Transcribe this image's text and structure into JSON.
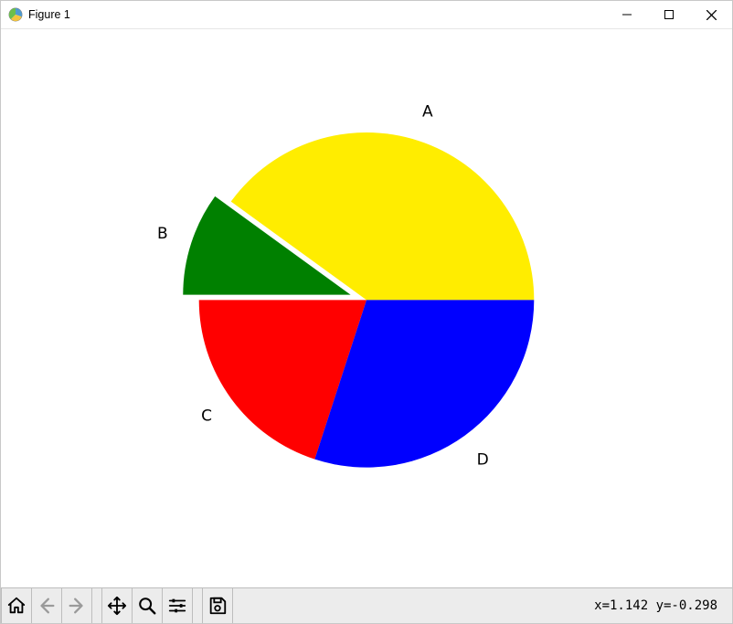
{
  "window": {
    "title": "Figure 1"
  },
  "status": {
    "coords": "x=1.142 y=-0.298"
  },
  "toolbar": {
    "home": "Home",
    "back": "Back",
    "forward": "Forward",
    "pan": "Pan",
    "zoom": "Zoom",
    "config": "Configure subplots",
    "save": "Save"
  },
  "chart_data": {
    "type": "pie",
    "title": "",
    "startangle": 0,
    "counterclockwise": true,
    "slices": [
      {
        "label": "A",
        "value": 40,
        "color": "#ffed00",
        "explode": 0.0
      },
      {
        "label": "B",
        "value": 10,
        "color": "#008000",
        "explode": 0.1
      },
      {
        "label": "C",
        "value": 20,
        "color": "#ff0000",
        "explode": 0.0
      },
      {
        "label": "D",
        "value": 30,
        "color": "#0000ff",
        "explode": 0.0
      }
    ]
  }
}
